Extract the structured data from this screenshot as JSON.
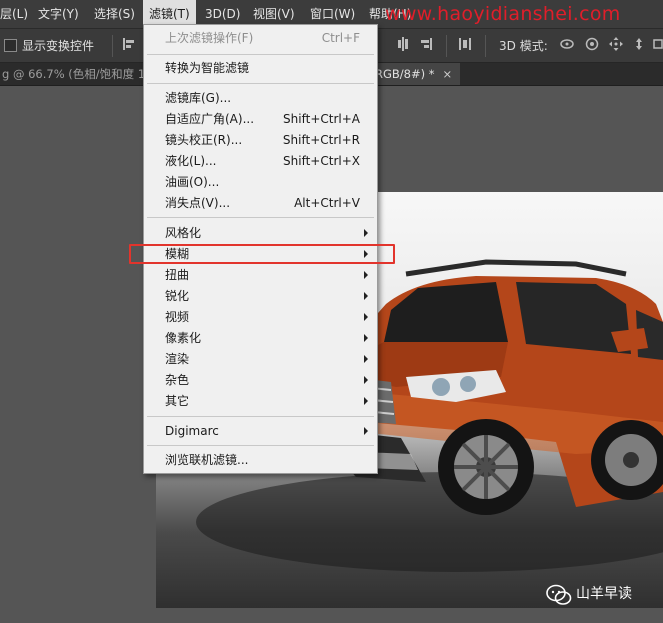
{
  "menubar": {
    "items": [
      {
        "label": "层(L)"
      },
      {
        "label": "文字(Y)"
      },
      {
        "label": "选择(S)"
      },
      {
        "label": "滤镜(T)"
      },
      {
        "label": "3D(D)"
      },
      {
        "label": "视图(V)"
      },
      {
        "label": "窗口(W)"
      },
      {
        "label": "帮助(H)"
      }
    ],
    "watermark": "www.haoyidianshei.com"
  },
  "options_bar": {
    "show_transform_controls_label": "显示变换控件",
    "mode_3d_label": "3D 模式:"
  },
  "tabs": {
    "doc1": "g @ 66.7% (色相/饱和度 1",
    "doc2": "RGB/8#) *",
    "close": "×"
  },
  "filter_menu": {
    "last_filter": {
      "label": "上次滤镜操作(F)",
      "shortcut": "Ctrl+F"
    },
    "convert_smart": {
      "label": "转换为智能滤镜"
    },
    "filter_gallery": {
      "label": "滤镜库(G)..."
    },
    "adaptive_wide_angle": {
      "label": "自适应广角(A)...",
      "shortcut": "Shift+Ctrl+A"
    },
    "lens_correction": {
      "label": "镜头校正(R)...",
      "shortcut": "Shift+Ctrl+R"
    },
    "liquify": {
      "label": "液化(L)...",
      "shortcut": "Shift+Ctrl+X"
    },
    "oil_paint": {
      "label": "油画(O)..."
    },
    "vanishing_point": {
      "label": "消失点(V)...",
      "shortcut": "Alt+Ctrl+V"
    },
    "submenus": [
      {
        "label": "风格化"
      },
      {
        "label": "模糊"
      },
      {
        "label": "扭曲"
      },
      {
        "label": "锐化"
      },
      {
        "label": "视频"
      },
      {
        "label": "像素化"
      },
      {
        "label": "渲染"
      },
      {
        "label": "杂色"
      },
      {
        "label": "其它"
      }
    ],
    "digimarc": {
      "label": "Digimarc"
    },
    "browse_online": {
      "label": "浏览联机滤镜..."
    }
  },
  "credit": "山羊早读",
  "colors": {
    "highlight": "#e2342c",
    "watermark": "#e01e2a",
    "car_body": "#b4461a"
  }
}
